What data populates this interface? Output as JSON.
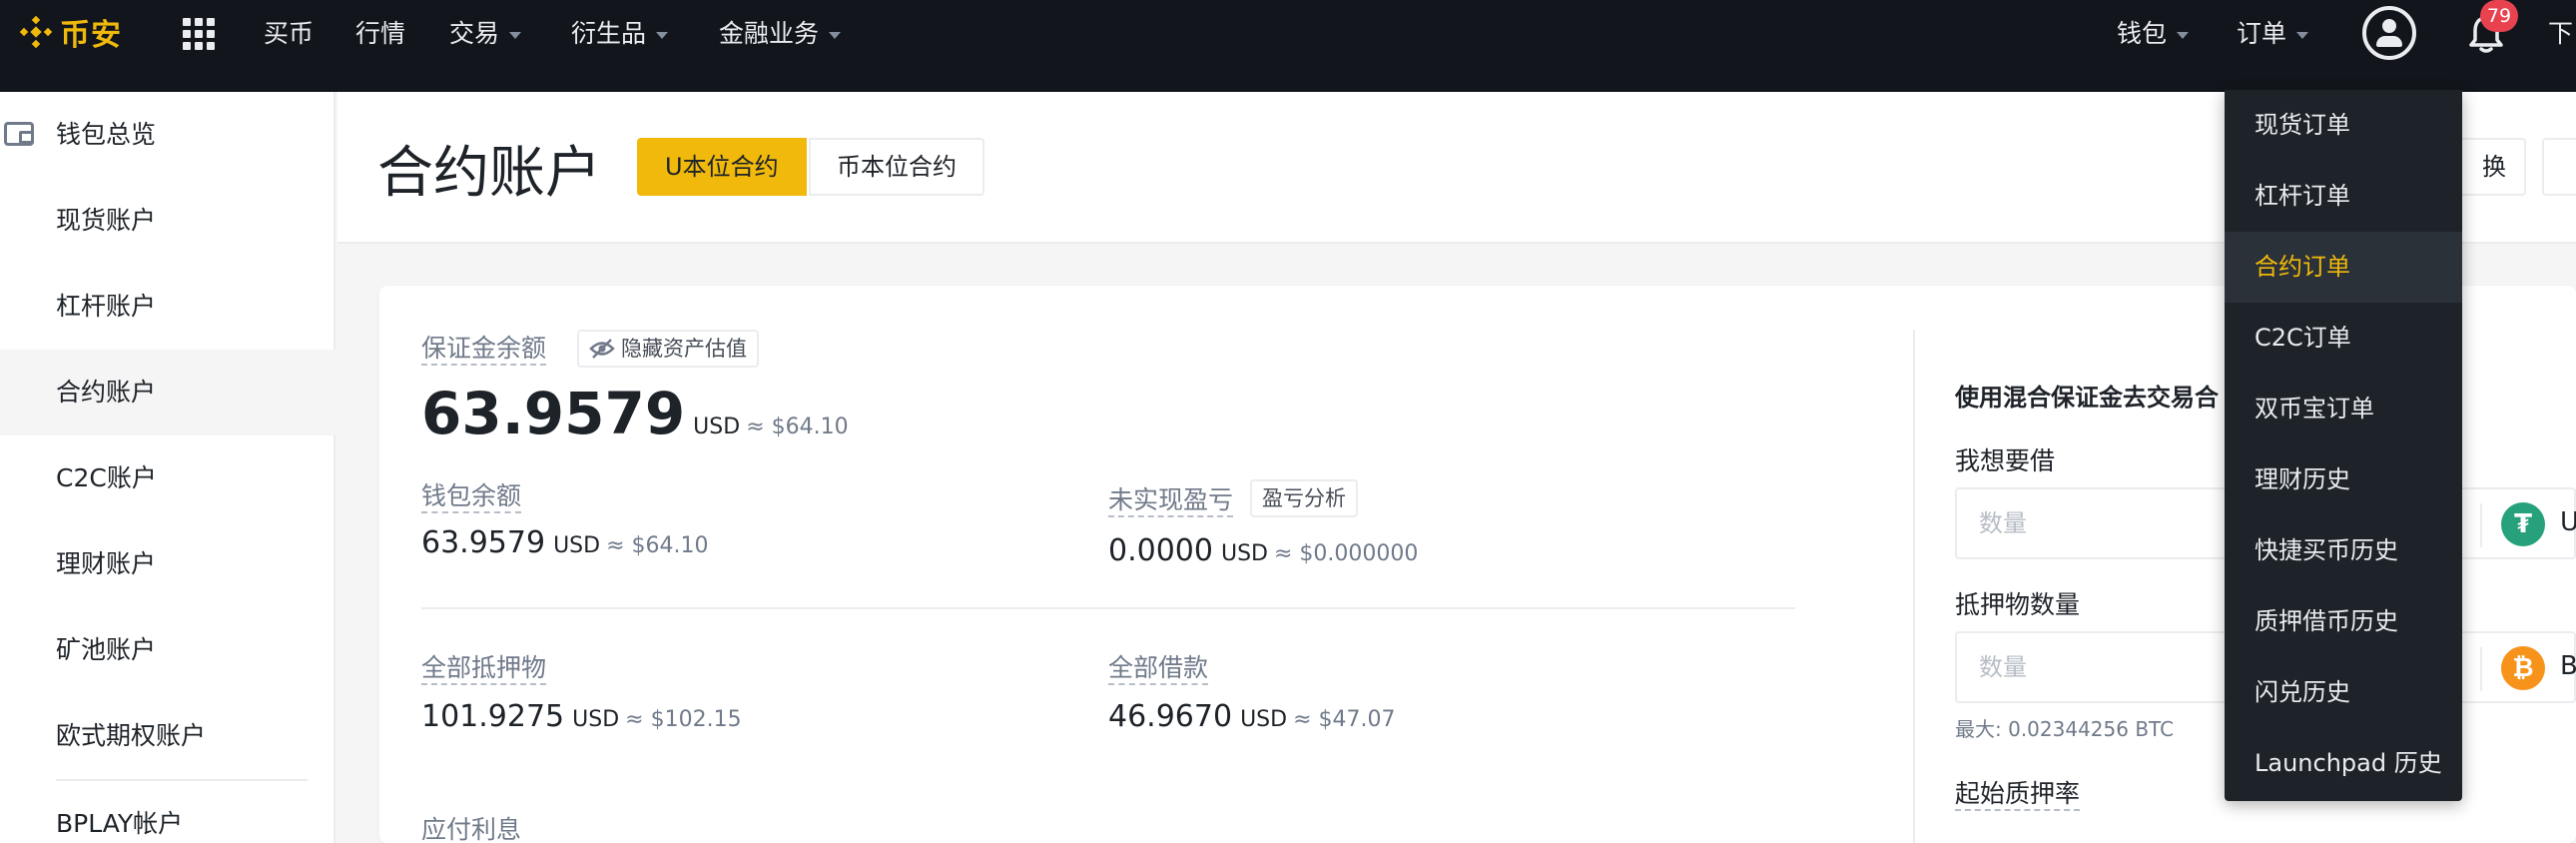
{
  "brand": {
    "name": "币安",
    "color": "#F0B90B"
  },
  "topnav": {
    "left_items": [
      {
        "label": "买币",
        "has_caret": false
      },
      {
        "label": "行情",
        "has_caret": false
      },
      {
        "label": "交易",
        "has_caret": true
      },
      {
        "label": "衍生品",
        "has_caret": true
      },
      {
        "label": "金融业务",
        "has_caret": true
      }
    ],
    "wallet": "钱包",
    "orders": "订单",
    "notification_count": "79",
    "download_partial": "下"
  },
  "sidebar": {
    "items": [
      {
        "label": "钱包总览",
        "icon": "wallet-icon"
      },
      {
        "label": "现货账户"
      },
      {
        "label": "杠杆账户"
      },
      {
        "label": "合约账户",
        "active": true
      },
      {
        "label": "C2C账户"
      },
      {
        "label": "理财账户"
      },
      {
        "label": "矿池账户"
      },
      {
        "label": "欧式期权账户"
      },
      {
        "label": "BPLAY帐户"
      }
    ]
  },
  "header": {
    "title": "合约账户",
    "tabs": [
      {
        "label": "U本位合约",
        "active": true
      },
      {
        "label": "币本位合约",
        "active": false
      }
    ],
    "right_button_partial": "换"
  },
  "summary": {
    "margin_balance": {
      "label": "保证金余额",
      "hide_label": "隐藏资产估值",
      "value": "63.9579",
      "unit": "USD",
      "approx": "≈ $64.10"
    },
    "wallet_balance": {
      "label": "钱包余额",
      "value": "63.9579",
      "unit": "USD",
      "approx": "≈ $64.10"
    },
    "unrealized_pnl": {
      "label": "未实现盈亏",
      "analysis_label": "盈亏分析",
      "value": "0.0000",
      "unit": "USD",
      "approx": "≈ $0.000000"
    },
    "total_collateral": {
      "label": "全部抵押物",
      "value": "101.9275",
      "unit": "USD",
      "approx": "≈ $102.15"
    },
    "total_borrowed": {
      "label": "全部借款",
      "value": "46.9670",
      "unit": "USD",
      "approx": "≈ $47.07"
    },
    "interest_payable": {
      "label": "应付利息"
    }
  },
  "borrow_panel": {
    "title": "使用混合保证金去交易合",
    "borrow_label": "我想要借",
    "borrow_placeholder": "数量",
    "borrow_coin": "U",
    "collateral_label": "抵押物数量",
    "collateral_placeholder": "数量",
    "collateral_coin": "B",
    "max_hint": "最大: 0.02344256 BTC",
    "initial_ltv_label": "起始质押率"
  },
  "orders_menu": {
    "items": [
      {
        "label": "现货订单"
      },
      {
        "label": "杠杆订单"
      },
      {
        "label": "合约订单",
        "active": true
      },
      {
        "label": "C2C订单"
      },
      {
        "label": "双币宝订单"
      },
      {
        "label": "理财历史"
      },
      {
        "label": "快捷买币历史"
      },
      {
        "label": "质押借币历史"
      },
      {
        "label": "闪兑历史"
      },
      {
        "label": "Launchpad 历史"
      }
    ]
  }
}
